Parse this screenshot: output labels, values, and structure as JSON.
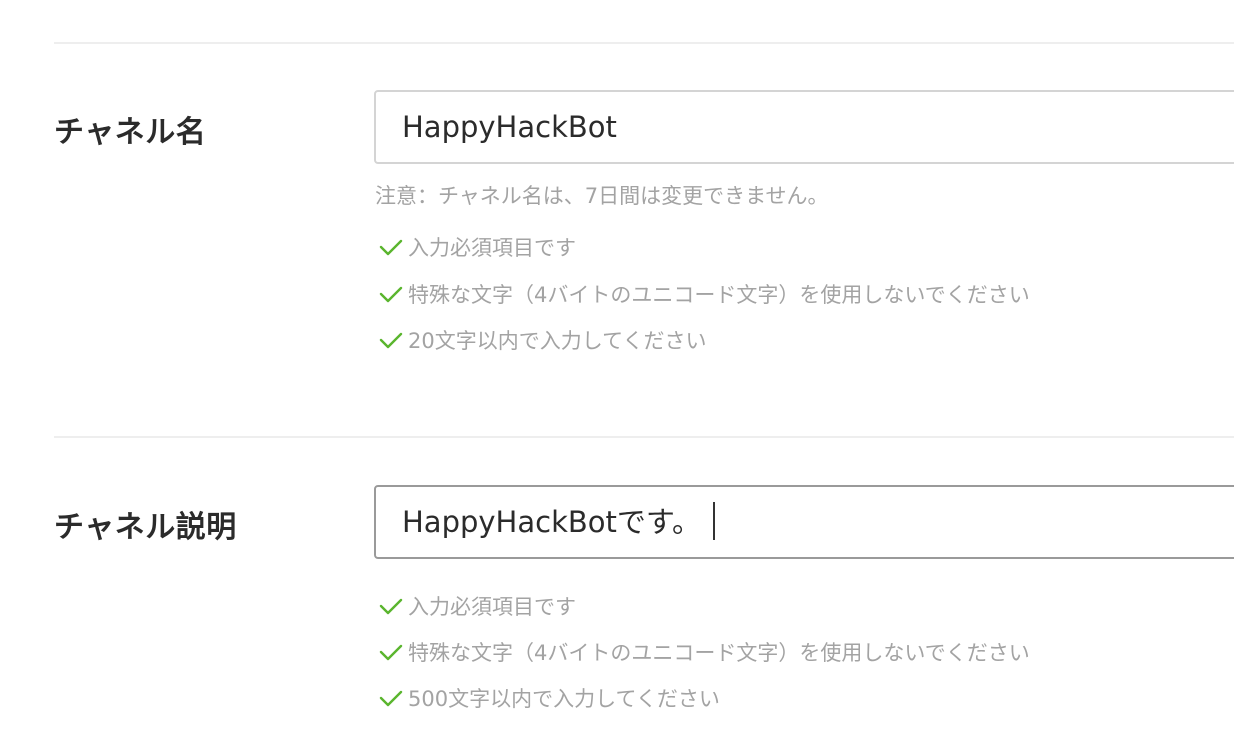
{
  "colors": {
    "check": "#5ab52e",
    "hint_text": "#a3a3a3",
    "label_text": "#2b2b2b",
    "border": "#d4d4d4"
  },
  "channel_name": {
    "label": "チャネル名",
    "value": "HappyHackBot",
    "note": "注意：チャネル名は、7日間は変更できません。",
    "rules": [
      {
        "icon": "check-icon",
        "text": "入力必須項目です"
      },
      {
        "icon": "check-icon",
        "text": "特殊な文字（4バイトのユニコード文字）を使用しないでください"
      },
      {
        "icon": "check-icon",
        "text": "20文字以内で入力してください"
      }
    ]
  },
  "channel_description": {
    "label": "チャネル説明",
    "value": "HappyHackBotです。",
    "rules": [
      {
        "icon": "check-icon",
        "text": "入力必須項目です"
      },
      {
        "icon": "check-icon",
        "text": "特殊な文字（4バイトのユニコード文字）を使用しないでください"
      },
      {
        "icon": "check-icon",
        "text": "500文字以内で入力してください"
      }
    ]
  }
}
